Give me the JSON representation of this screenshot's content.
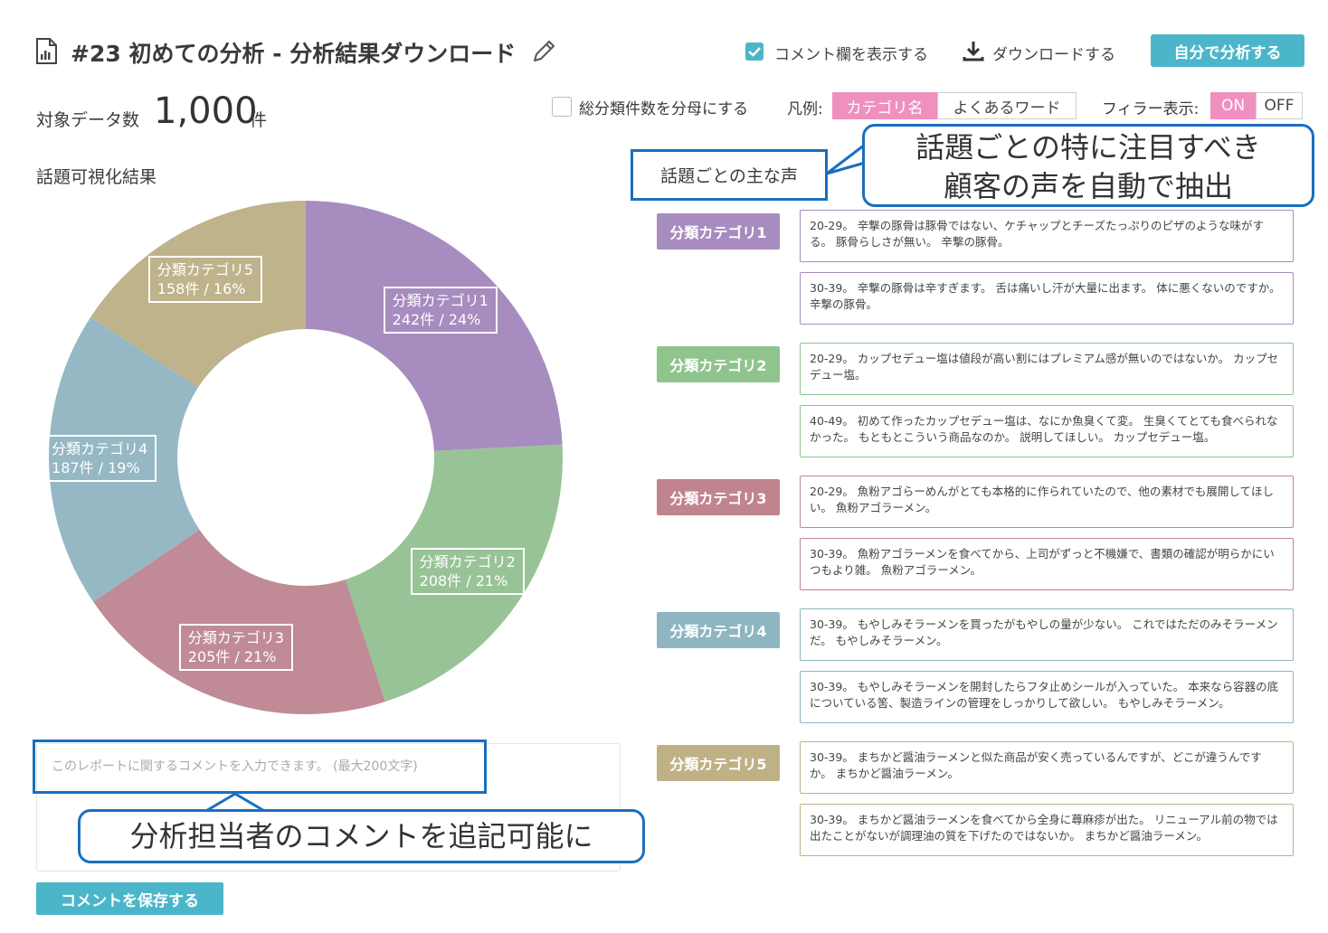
{
  "header": {
    "title": "#23 初めての分析 - 分析結果ダウンロード",
    "show_comment_label": "コメント欄を表示する",
    "show_comment_checked": true,
    "download_label": "ダウンロードする",
    "self_analyze_button": "自分で分析する"
  },
  "summary": {
    "label": "対象データ数",
    "value": "1,000",
    "unit": "件"
  },
  "options": {
    "denominator_label": "総分類件数を分母にする",
    "denominator_checked": false,
    "legend_label": "凡例:",
    "legend_options": [
      "カテゴリ名",
      "よくあるワード"
    ],
    "legend_selected": "カテゴリ名",
    "filler_label": "フィラー表示:",
    "filler_options": [
      "ON",
      "OFF"
    ],
    "filler_selected": "ON"
  },
  "left_section_title": "話題可視化結果",
  "chart_data": {
    "type": "pie",
    "donut": true,
    "categories": [
      "分類カテゴリ1",
      "分類カテゴリ2",
      "分類カテゴリ3",
      "分類カテゴリ4",
      "分類カテゴリ5"
    ],
    "values": [
      242,
      208,
      205,
      187,
      158
    ],
    "labels": [
      {
        "name": "分類カテゴリ1",
        "detail": "242件 / 24%"
      },
      {
        "name": "分類カテゴリ2",
        "detail": "208件 / 21%"
      },
      {
        "name": "分類カテゴリ3",
        "detail": "205件 / 21%"
      },
      {
        "name": "分類カテゴリ4",
        "detail": "187件 / 19%"
      },
      {
        "name": "分類カテゴリ5",
        "detail": "158件 / 16%"
      }
    ],
    "colors": [
      "#a78cc0",
      "#98c396",
      "#c08b97",
      "#95b8c4",
      "#bfb38c"
    ]
  },
  "right_section_title": "話題ごとの主な声",
  "callout_top": [
    "話題ごとの特に注目すべき",
    "顧客の声を自動で抽出"
  ],
  "callout_bottom": "分析担当者のコメントを追記可能に",
  "voice_groups": [
    {
      "category": "分類カテゴリ1",
      "color": "#a78cc0",
      "voices": [
        "20-29。 辛撃の豚骨は豚骨ではない、ケチャップとチーズたっぷりのピザのような味がする。 豚骨らしさが無い。 辛撃の豚骨。",
        "30-39。 辛撃の豚骨は辛すぎます。 舌は痛いし汗が大量に出ます。 体に悪くないのですか。 辛撃の豚骨。"
      ]
    },
    {
      "category": "分類カテゴリ2",
      "color": "#8fc48d",
      "voices": [
        "20-29。 カップセデュー塩は値段が高い割にはプレミアム感が無いのではないか。 カップセデュー塩。",
        "40-49。 初めて作ったカップセデュー塩は、なにか魚臭くて変。 生臭くてとても食べられなかった。 もともとこういう商品なのか。 説明してほしい。 カップセデュー塩。"
      ]
    },
    {
      "category": "分類カテゴリ3",
      "color": "#c0848f",
      "voices": [
        "20-29。 魚粉アゴらーめんがとても本格的に作られていたので、他の素材でも展開してほしい。 魚粉アゴラーメン。",
        "30-39。 魚粉アゴラーメンを食べてから、上司がずっと不機嫌で、書類の確認が明らかにいつもより雑。 魚粉アゴラーメン。"
      ]
    },
    {
      "category": "分類カテゴリ4",
      "color": "#8fb5c1",
      "voices": [
        "30-39。 もやしみそラーメンを買ったがもやしの量が少ない。 これではただのみそラーメンだ。 もやしみそラーメン。",
        "30-39。 もやしみそラーメンを開封したらフタ止めシールが入っていた。 本来なら容器の底についている筈、製造ラインの管理をしっかりして欲しい。 もやしみそラーメン。"
      ]
    },
    {
      "category": "分類カテゴリ5",
      "color": "#bfb186",
      "voices": [
        "30-39。 まちかど醤油ラーメンと似た商品が安く売っているんですが、どこが違うんですか。 まちかど醤油ラーメン。",
        "30-39。 まちかど醤油ラーメンを食べてから全身に蕁麻疹が出た。 リニューアル前の物では出たことがないが調理油の質を下げたのではないか。 まちかど醤油ラーメン。"
      ]
    }
  ],
  "comment": {
    "placeholder": "このレポートに関するコメントを入力できます。 (最大200文字)",
    "value": "",
    "save_button": "コメントを保存する"
  }
}
